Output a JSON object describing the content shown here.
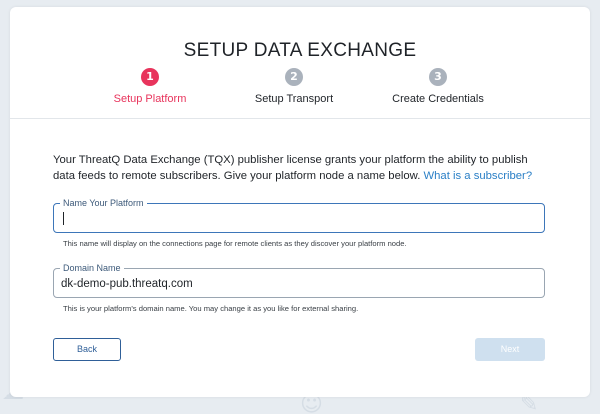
{
  "page": {
    "title": "SETUP DATA EXCHANGE"
  },
  "steps": [
    {
      "number": "1",
      "label": "Setup Platform",
      "state": "active"
    },
    {
      "number": "2",
      "label": "Setup Transport",
      "state": "inactive"
    },
    {
      "number": "3",
      "label": "Create Credentials",
      "state": "inactive"
    }
  ],
  "intro": {
    "text": "Your ThreatQ Data Exchange (TQX) publisher license grants your platform the ability to publish data feeds to remote subscribers. Give your platform node a name below.",
    "link": "What is a subscriber?"
  },
  "fields": {
    "platform_name": {
      "label": "Name Your Platform",
      "value": "",
      "help": "This name will display on the connections page for remote clients as they discover your platform node."
    },
    "domain_name": {
      "label": "Domain Name",
      "value": "dk-demo-pub.threatq.com",
      "help": "This is your platform's domain name. You may change it as you like for external sharing."
    }
  },
  "buttons": {
    "back": "Back",
    "next": "Next"
  },
  "colors": {
    "active_step": "#e8345c",
    "inactive_step": "#aab2bc",
    "link": "#2a7fc6",
    "back_border": "#2f5f98",
    "next_disabled_bg": "#cfe0ef"
  }
}
